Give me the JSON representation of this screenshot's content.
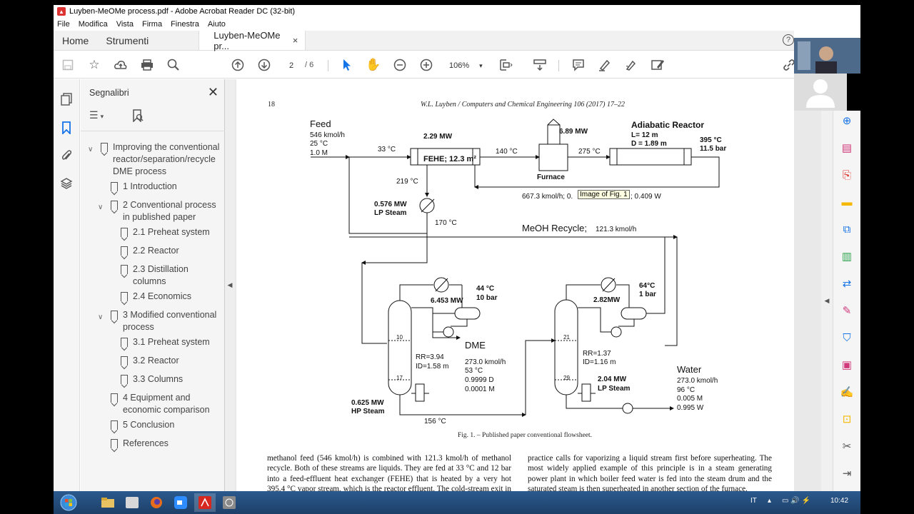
{
  "window": {
    "title": "Luyben-MeOMe process.pdf - Adobe Acrobat Reader DC (32-bit)",
    "menu": [
      "File",
      "Modifica",
      "Vista",
      "Firma",
      "Finestra",
      "Aiuto"
    ]
  },
  "tabs": {
    "home": "Home",
    "tools": "Strumenti",
    "doc": "Luyben-MeOMe pr...",
    "close": "×",
    "help": "?"
  },
  "toolbar": {
    "page_current": "2",
    "page_total": "/ 6",
    "zoom": "106%",
    "zoom_arrow": "▾"
  },
  "bookmarks": {
    "title": "Segnalibri",
    "close": "✕",
    "items": [
      {
        "label": "Improving the conventional reactor/separation/recycle DME process",
        "level": 0,
        "expanded": true
      },
      {
        "label": "1 Introduction",
        "level": 1
      },
      {
        "label": "2 Conventional process in published paper",
        "level": 1,
        "expanded": true
      },
      {
        "label": "2.1 Preheat system",
        "level": 2
      },
      {
        "label": "2.2 Reactor",
        "level": 2
      },
      {
        "label": "2.3 Distillation columns",
        "level": 2
      },
      {
        "label": "2.4 Economics",
        "level": 2
      },
      {
        "label": "3 Modified conventional process",
        "level": 1,
        "expanded": true
      },
      {
        "label": "3.1 Preheat system",
        "level": 2
      },
      {
        "label": "3.2 Reactor",
        "level": 2
      },
      {
        "label": "3.3 Columns",
        "level": 2
      },
      {
        "label": "4 Equipment and economic comparison",
        "level": 1
      },
      {
        "label": "5 Conclusion",
        "level": 1
      },
      {
        "label": "References",
        "level": 1
      }
    ]
  },
  "page": {
    "page_number": "18",
    "journal": "W.L. Luyben / Computers and Chemical Engineering 106 (2017) 17–22",
    "caption": "Fig. 1.  – Published paper conventional flowsheet.",
    "tooltip": "Image of Fig. 1",
    "body_left": "methanol feed (546 kmol/h) is combined with 121.3 kmol/h of methanol recycle. Both of these streams are liquids. They are fed at 33 °C and 12 bar into a feed-effluent heat exchanger (FEHE) that is heated by a very hot 395.4 °C vapor stream, which is the reactor effluent. The cold-stream exit in the FEHE is liquid so the cold",
    "body_right": "practice calls for vaporizing a liquid stream first before superheating. The most widely applied example of this principle is in a steam generating power plant in which boiler feed water is fed into the steam drum and the saturated steam is then superheated in another section of the furnace."
  },
  "flowsheet": {
    "feed": "Feed",
    "feed_flow": "546 kmol/h",
    "feed_temp": "25 °C",
    "feed_comp": "1.0 M",
    "t33": "33 °C",
    "fehe_duty": "2.29 MW",
    "fehe_label": "FEHE; 12.3 m²",
    "t140": "140 °C",
    "furnace_duty": "6.89 MW",
    "furnace": "Furnace",
    "t275": "275 °C",
    "reactor": "Adiabatic Reactor",
    "reactor_l": "L= 12 m",
    "reactor_d": "D = 1.89 m",
    "t395": "395 °C",
    "p115": "11.5 bar",
    "t219": "219 °C",
    "effluent_a": "667.3 kmol/h; 0.",
    "effluent_b": "; 0.409 W",
    "lp_duty": "0.576 MW",
    "lp_steam": "LP Steam",
    "t170": "170 °C",
    "recycle": "MeOH Recycle;",
    "recycle_flow": "121.3 kmol/h",
    "c1_cond_duty": "6.453 MW",
    "c1_t": "44 °C",
    "c1_p": "10 bar",
    "c1_stage_top": "10",
    "c1_stage_bot": "17",
    "c1_rr": "RR=3.94",
    "c1_id": "ID=1.58 m",
    "dme": "DME",
    "dme_flow": "273.0 kmol/h",
    "dme_t": "53 °C",
    "dme_d": "0.9999 D",
    "dme_m": "0.0001 M",
    "c1_reb_duty": "0.625 MW",
    "c1_reb_steam": "HP Steam",
    "t156": "156 °C",
    "c2_cond_duty": "2.82MW",
    "c2_t": "64°C",
    "c2_p": "1 bar",
    "c2_stage_top": "21",
    "c2_stage_bot": "29",
    "c2_rr": "RR=1.37",
    "c2_id": "ID=1.16 m",
    "c2_reb_duty": "2.04 MW",
    "c2_reb_steam": "LP Steam",
    "water": "Water",
    "water_flow": "273.0 kmol/h",
    "water_t": "96 °C",
    "water_m": "0.005 M",
    "water_w": "0.995 W"
  },
  "taskbar": {
    "lang": "IT",
    "time": "10:42"
  }
}
